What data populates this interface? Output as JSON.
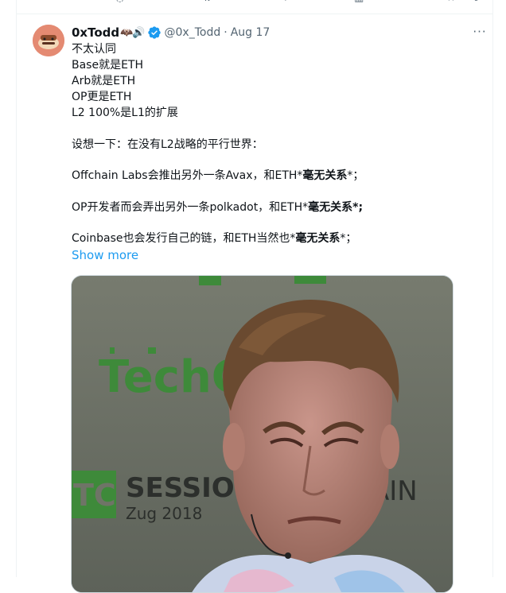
{
  "tweet": {
    "author_name": "0xTodd",
    "name_suffix_emoji": "🦇🔊",
    "handle": "@0x_Todd",
    "separator": "·",
    "date": "Aug 17",
    "more_label": "···",
    "show_more_label": "Show more",
    "text_lines": [
      "不太认同",
      "Base就是ETH",
      "Arb就是ETH",
      "OP更是ETH",
      "L2 100%是L1的扩展",
      "",
      "设想一下：在没有L2战略的平行世界：",
      "",
      "Offchain Labs会推出另外一条Avax，和ETH*",
      "",
      "OP开发者而会弄出另外一条polkadot，和ETH*",
      "",
      "Coinbase也会发行自己的链，和ETH当然也*"
    ],
    "emphasis": {
      "bold_phrase": "毫无关系",
      "tail_a": "*；",
      "tail_b": "*;"
    }
  },
  "media": {
    "alt": "Photo of a man speaking on stage",
    "backdrop_word_1": "TechC",
    "backdrop_word_2": "SESSIONS",
    "backdrop_word_3": "Zug 2018",
    "backdrop_word_4": "AIN",
    "backdrop_logo": "TC"
  },
  "colors": {
    "link": "#1d9bf0",
    "secondary_text": "#536471",
    "verified_badge": "#1d9bf0",
    "backdrop_green": "#3e8a3a"
  }
}
